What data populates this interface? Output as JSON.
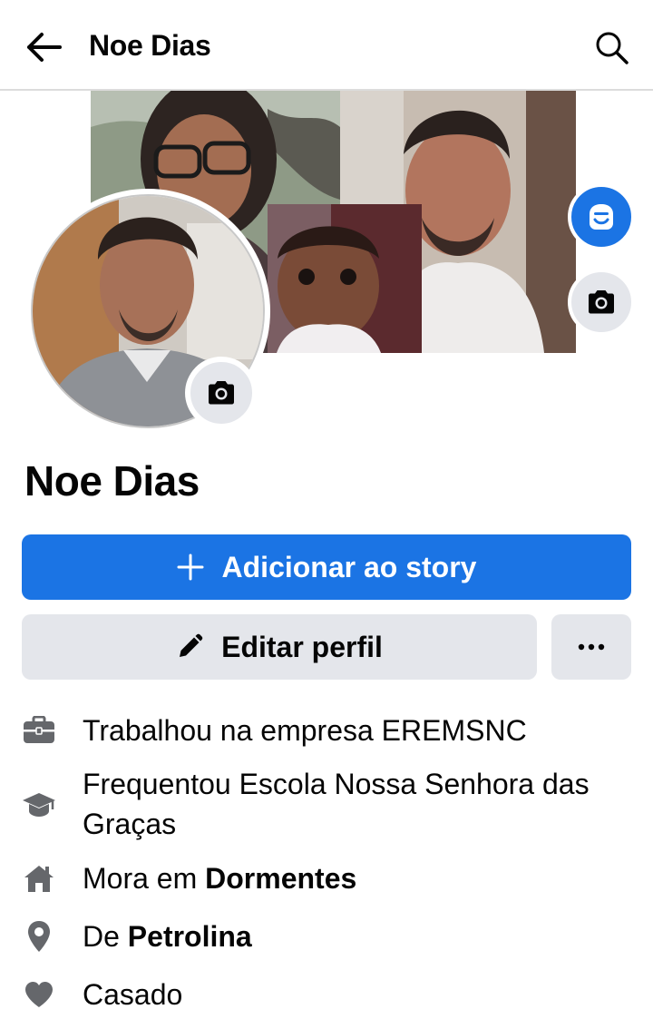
{
  "header": {
    "title": "Noe Dias",
    "back_icon": "arrow-left-icon",
    "search_icon": "search-icon"
  },
  "profile": {
    "name": "Noe Dias"
  },
  "actions": {
    "add_story_label": "Adicionar ao story",
    "edit_profile_label": "Editar perfil",
    "more_label": "···"
  },
  "details": [
    {
      "icon": "briefcase-icon",
      "text": "Trabalhou na empresa EREMSNC"
    },
    {
      "icon": "graduation-cap-icon",
      "text": "Frequentou Escola Nossa Senhora das Graças"
    },
    {
      "icon": "home-icon",
      "prefix": "Mora em ",
      "bold": "Dormentes"
    },
    {
      "icon": "location-pin-icon",
      "prefix": "De ",
      "bold": "Petrolina"
    },
    {
      "icon": "heart-icon",
      "text": "Casado"
    }
  ],
  "colors": {
    "accent": "#1b74e4",
    "button_gray": "#e4e6eb",
    "icon_gray": "#65676b",
    "text": "#050505"
  }
}
